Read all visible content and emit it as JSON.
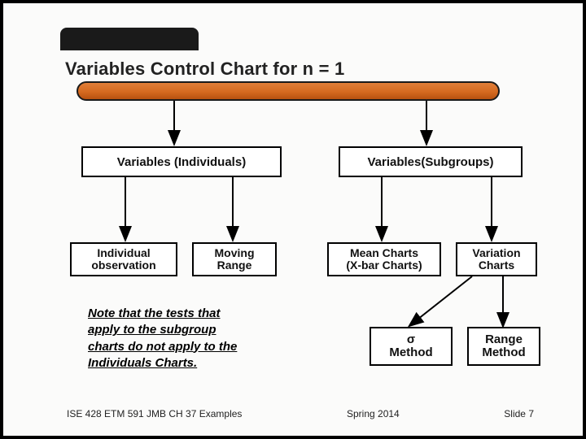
{
  "title": "Variables Control Chart for n = 1",
  "level1": {
    "left": "Variables (Individuals)",
    "right": "Variables(Subgroups)"
  },
  "level2": {
    "a": {
      "line1": "Individual",
      "line2": "observation"
    },
    "b": {
      "line1": "Moving",
      "line2": "Range"
    },
    "c": {
      "line1": "Mean Charts",
      "line2": "(X-bar Charts)"
    },
    "d": {
      "line1": "Variation",
      "line2": "Charts"
    }
  },
  "level3": {
    "e": {
      "line1": "σ",
      "line2": "Method"
    },
    "f": {
      "line1": "Range",
      "line2": "Method"
    }
  },
  "note": {
    "l1": "Note that the tests that",
    "l2": "apply to the subgroup",
    "l3": "charts do not apply to the",
    "l4": "Individuals Charts."
  },
  "footer": {
    "left": "ISE 428  ETM 591 JMB   CH 37 Examples",
    "mid": "Spring 2014",
    "right": "Slide 7"
  }
}
